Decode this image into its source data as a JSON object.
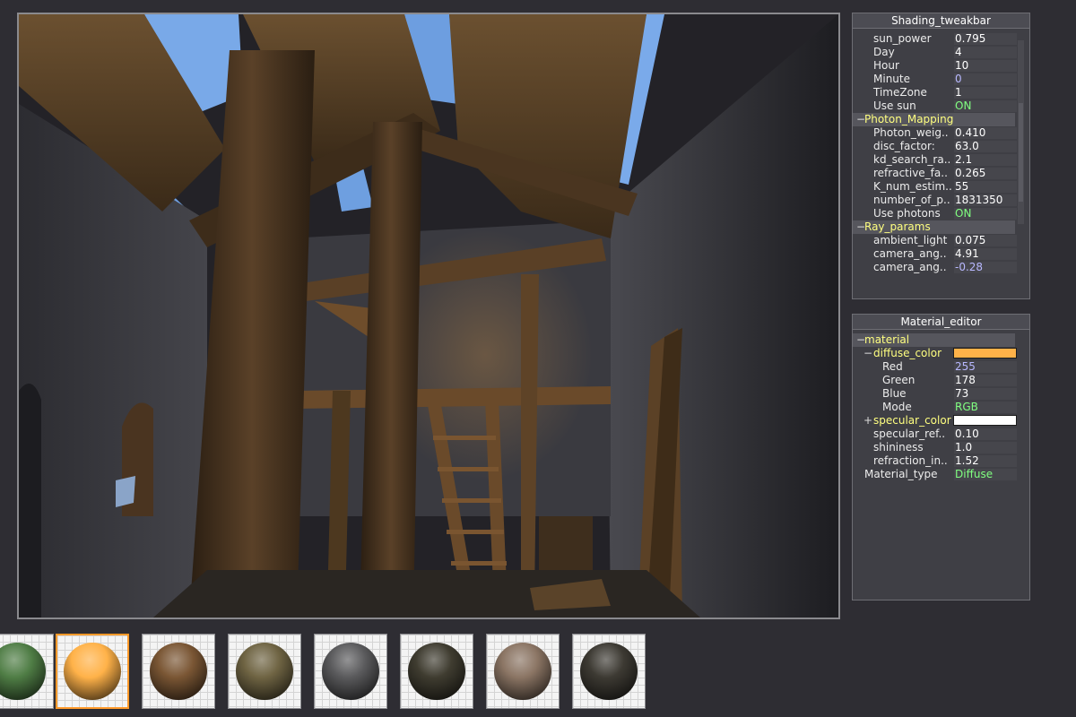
{
  "shading_panel": {
    "title": "Shading_tweakbar",
    "rows": [
      {
        "label": "sun_power",
        "value": "0.795"
      },
      {
        "label": "Day",
        "value": "4"
      },
      {
        "label": "Hour",
        "value": "10"
      },
      {
        "label": "Minute",
        "value": "0"
      },
      {
        "label": "TimeZone",
        "value": "1"
      },
      {
        "label": "Use sun",
        "value": "ON"
      }
    ],
    "photon_group": {
      "toggle": "−",
      "label": "Photon_Mapping",
      "rows": [
        {
          "label": "Photon_weig..",
          "value": "0.410"
        },
        {
          "label": "disc_factor:",
          "value": "63.0"
        },
        {
          "label": "kd_search_ra..",
          "value": "2.1"
        },
        {
          "label": "refractive_fa..",
          "value": "0.265"
        },
        {
          "label": "K_num_estim..",
          "value": "55"
        },
        {
          "label": "number_of_p..",
          "value": "1831350"
        },
        {
          "label": "Use photons",
          "value": "ON"
        }
      ]
    },
    "ray_group": {
      "toggle": "−",
      "label": "Ray_params",
      "rows": [
        {
          "label": "ambient_light",
          "value": "0.075"
        },
        {
          "label": "camera_ang..",
          "value": "4.91"
        },
        {
          "label": "camera_ang..",
          "value": "-0.28"
        }
      ]
    }
  },
  "material_panel": {
    "title": "Material_editor",
    "group": {
      "toggle": "−",
      "label": "material"
    },
    "diffuse": {
      "toggle": "−",
      "label": "diffuse_color",
      "color": "#ffb249",
      "rows": [
        {
          "label": "Red",
          "value": "255"
        },
        {
          "label": "Green",
          "value": "178"
        },
        {
          "label": "Blue",
          "value": "73"
        },
        {
          "label": "Mode",
          "value": "RGB"
        }
      ]
    },
    "specular": {
      "toggle": "+",
      "label": "specular_color",
      "color": "#ffffff"
    },
    "rows": [
      {
        "label": "specular_ref..",
        "value": "0.10"
      },
      {
        "label": "shininess",
        "value": "1.0"
      },
      {
        "label": "refraction_in..",
        "value": "1.52"
      }
    ],
    "material_type": {
      "label": "Material_type",
      "value": "Diffuse"
    }
  },
  "materials_strip": {
    "swatches": [
      {
        "name": "green",
        "color": "#4f7d45"
      },
      {
        "name": "orange",
        "color": "#ffb249"
      },
      {
        "name": "brown",
        "color": "#7a5634"
      },
      {
        "name": "olive",
        "color": "#6f6443"
      },
      {
        "name": "gray",
        "color": "#5a5a5c"
      },
      {
        "name": "dark-olive",
        "color": "#3f3c30"
      },
      {
        "name": "taupe",
        "color": "#8b7564"
      },
      {
        "name": "charcoal",
        "color": "#3d3a33"
      }
    ],
    "selected_index": 1
  },
  "colors": {
    "label_yellow": "#ffff80",
    "value_green": "#80ff80",
    "value_blue": "#b8b8ff",
    "selection_orange": "#ff9a2a"
  }
}
